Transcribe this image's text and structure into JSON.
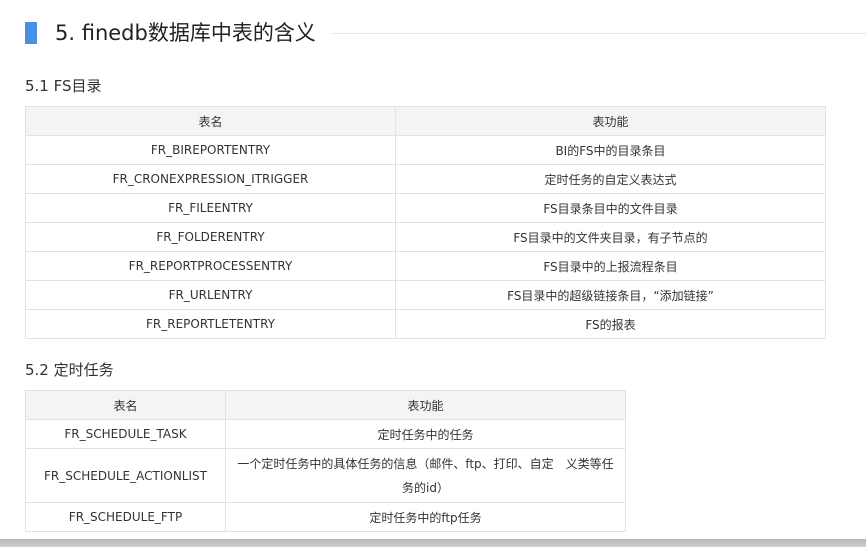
{
  "section": {
    "title": "5. finedb数据库中表的含义"
  },
  "fs": {
    "heading": "5.1 FS目录",
    "headers": [
      "表名",
      "表功能"
    ],
    "rows": [
      [
        "FR_BIREPORTENTRY",
        "BI的FS中的目录条目"
      ],
      [
        "FR_CRONEXPRESSION_ITRIGGER",
        "定时任务的自定义表达式"
      ],
      [
        "FR_FILEENTRY",
        "FS目录条目中的文件目录"
      ],
      [
        "FR_FOLDERENTRY",
        "FS目录中的文件夹目录，有子节点的"
      ],
      [
        "FR_REPORTPROCESSENTRY",
        "FS目录中的上报流程条目"
      ],
      [
        "FR_URLENTRY",
        "FS目录中的超级链接条目，“添加链接”"
      ],
      [
        "FR_REPORTLETENTRY",
        "FS的报表"
      ]
    ]
  },
  "schedule": {
    "heading": "5.2 定时任务",
    "headers": [
      "表名",
      "表功能"
    ],
    "rows": [
      [
        "FR_SCHEDULE_TASK",
        "定时任务中的任务"
      ],
      [
        "FR_SCHEDULE_ACTIONLIST",
        "一个定时任务中的具体任务的信息（邮件、ftp、打印、自定　义类等任务的id）"
      ],
      [
        "FR_SCHEDULE_FTP",
        "定时任务中的ftp任务"
      ]
    ]
  }
}
